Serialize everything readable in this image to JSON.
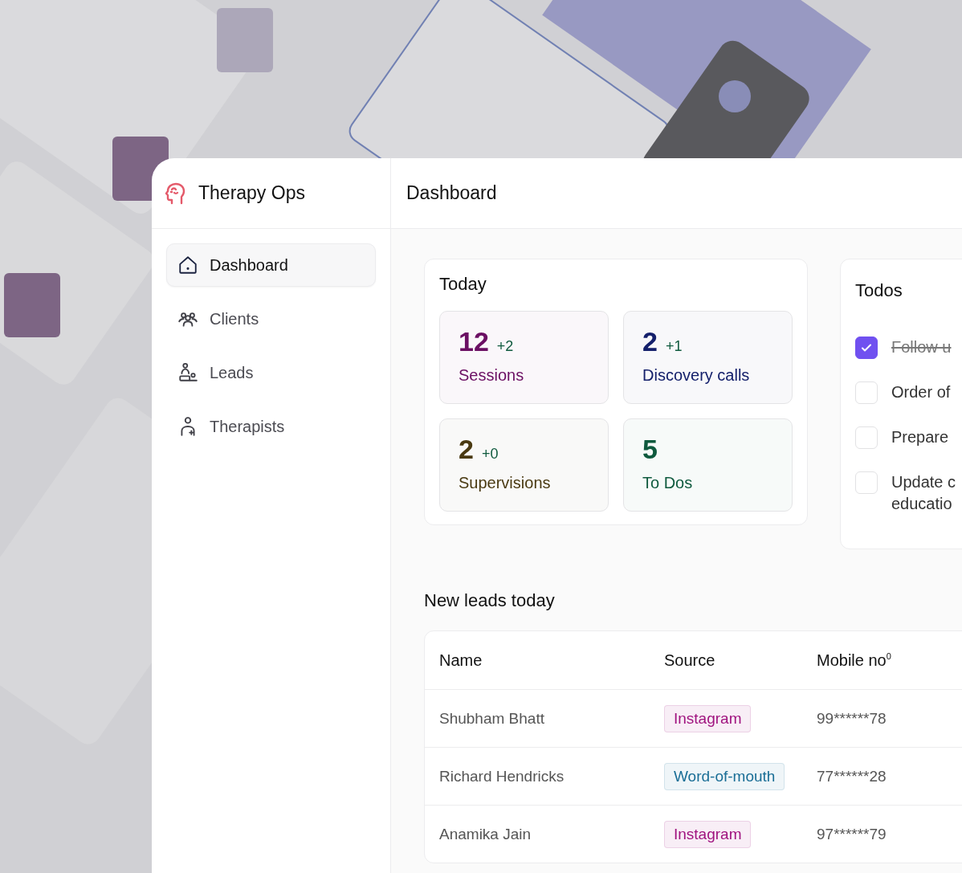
{
  "app": {
    "name": "Therapy Ops"
  },
  "sidebar": {
    "items": [
      {
        "label": "Dashboard",
        "selected": true
      },
      {
        "label": "Clients",
        "selected": false
      },
      {
        "label": "Leads",
        "selected": false
      },
      {
        "label": "Therapists",
        "selected": false
      }
    ]
  },
  "header": {
    "title": "Dashboard"
  },
  "today": {
    "title": "Today",
    "stats": [
      {
        "value": "12",
        "delta": "+2",
        "label": "Sessions",
        "color": "#6b0f63"
      },
      {
        "value": "2",
        "delta": "+1",
        "label": "Discovery calls",
        "color": "#14206b"
      },
      {
        "value": "2",
        "delta": "+0",
        "label": "Supervisions",
        "color": "#4a3a12"
      },
      {
        "value": "5",
        "label": "To Dos",
        "color": "#0f5a3e"
      }
    ]
  },
  "todos": {
    "title": "Todos",
    "items": [
      {
        "text": "Follow u",
        "checked": true
      },
      {
        "text": "Order of",
        "checked": false
      },
      {
        "text": "Prepare",
        "checked": false
      },
      {
        "text": "Update c\neducatio",
        "checked": false
      }
    ]
  },
  "leads": {
    "title": "New leads today",
    "columns": [
      "Name",
      "Source",
      "Mobile no$^{0}$"
    ],
    "rows": [
      {
        "name": "Shubham Bhatt",
        "source": "Instagram",
        "color": "#a0137f",
        "mobile": "99******78"
      },
      {
        "name": "Richard Hendricks",
        "source": "Word-of-mouth",
        "color": "#1a6e96",
        "mobile": "77******28"
      },
      {
        "name": "Anamika Jain",
        "source": "Instagram",
        "color": "#a0137f",
        "mobile": "97******79"
      }
    ]
  }
}
